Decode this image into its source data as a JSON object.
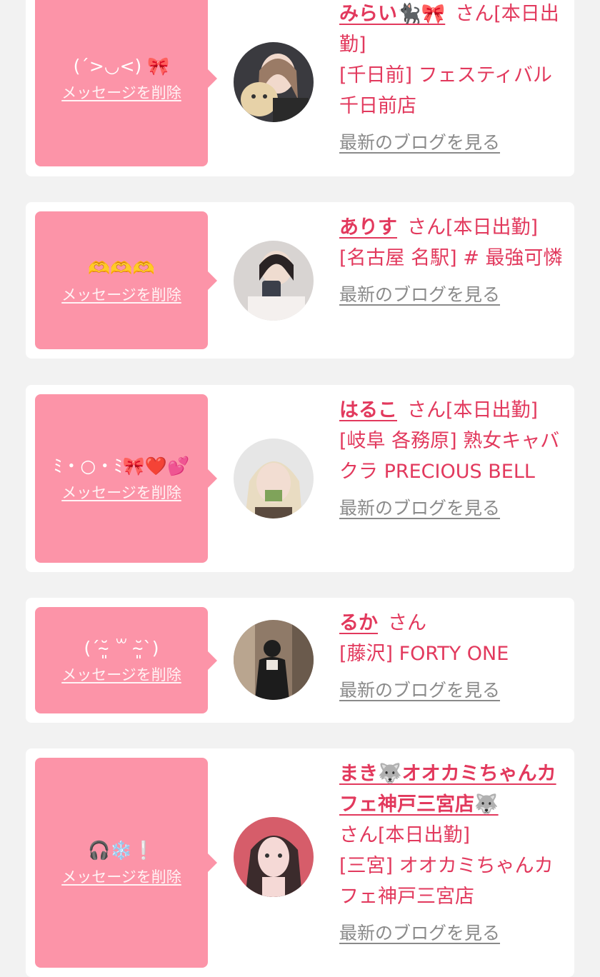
{
  "cards": [
    {
      "message": "(ˊ>◡<) 🎀",
      "delete_label": "メッセージを削除",
      "name": "みらい🐈‍⬛🎀",
      "suffix": "さん[本日出勤]",
      "shop": "[千日前] フェスティバル千日前店",
      "blog_label": "最新のブログを見る"
    },
    {
      "message": "🫶🫶🫶",
      "delete_label": "メッセージを削除",
      "name": "ありす",
      "suffix": "さん[本日出勤]",
      "shop": "[名古屋 名駅]  # 最強可憐",
      "blog_label": "最新のブログを見る"
    },
    {
      "message": "ﾐ・○・ﾐ🎀❤️💕",
      "delete_label": "メッセージを削除",
      "name": "はるこ",
      "suffix": "さん[本日出勤]",
      "shop": "[岐阜 各務原]  熟女キャバクラ PRECIOUS BELL",
      "blog_label": "最新のブログを見る"
    },
    {
      "message": "(ˊ˘̴͈ ꒳ ˘̴͈ˋ)",
      "delete_label": "メッセージを削除",
      "name": "るか",
      "suffix": "さん",
      "shop": "[藤沢] FORTY ONE",
      "blog_label": "最新のブログを見る"
    },
    {
      "message": "🎧❄️❕",
      "delete_label": "メッセージを削除",
      "name": "まき🐺オオカミちゃんカフェ神戸三宮店🐺",
      "suffix": "さん[本日出勤]",
      "shop": "[三宮] オオカミちゃんカフェ神戸三宮店",
      "blog_label": "最新のブログを見る"
    }
  ],
  "colors": {
    "accent": "#e2395d",
    "bubble": "#fc94a8",
    "link_gray": "#8a8a8a",
    "background": "#f2f2f2"
  }
}
